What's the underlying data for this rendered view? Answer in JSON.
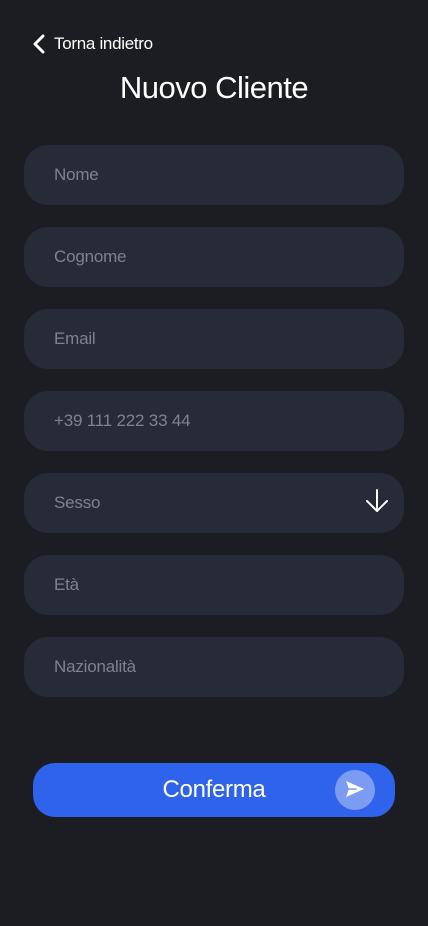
{
  "header": {
    "back_label": "Torna indietro",
    "title": "Nuovo Cliente"
  },
  "form": {
    "nome_placeholder": "Nome",
    "cognome_placeholder": "Cognome",
    "email_placeholder": "Email",
    "phone_placeholder": "+39 111 222 33 44",
    "sesso_placeholder": "Sesso",
    "eta_placeholder": "Età",
    "nazionalita_placeholder": "Nazionalità"
  },
  "actions": {
    "confirm_label": "Conferma"
  },
  "icons": {
    "back": "chevron-left-icon",
    "dropdown": "arrow-down-icon",
    "send": "send-icon"
  },
  "colors": {
    "background": "#1c1d22",
    "field": "#272b37",
    "placeholder": "#7d8290",
    "accent": "#2f63ec",
    "send_circle": "#7c9bf3"
  }
}
